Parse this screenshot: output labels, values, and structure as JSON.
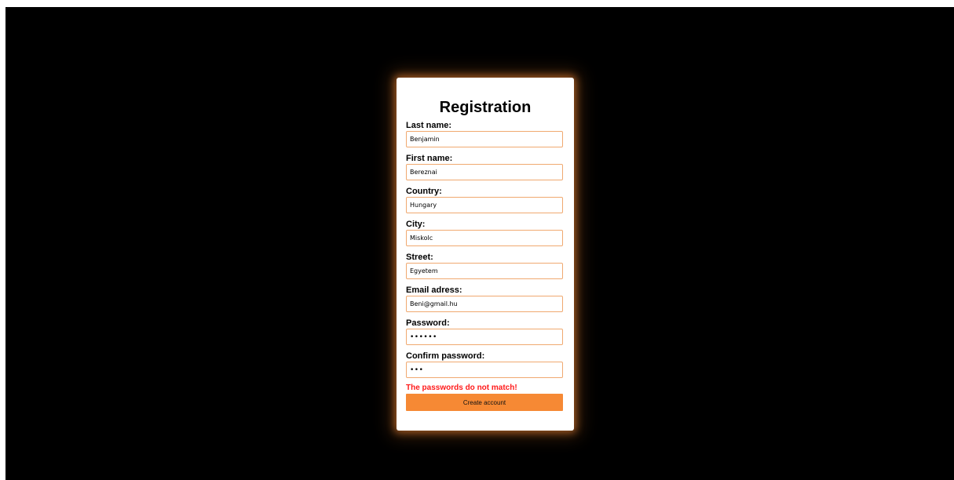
{
  "colors": {
    "background": "#000000",
    "card": "#ffffff",
    "accent": "#f68934",
    "input_border": "#f0a970",
    "error": "#ff1a1a"
  },
  "form": {
    "title": "Registration",
    "fields": [
      {
        "label": "Last name:",
        "value": "Benjamin",
        "type": "text"
      },
      {
        "label": "First name:",
        "value": "Bereznai",
        "type": "text"
      },
      {
        "label": "Country:",
        "value": "Hungary",
        "type": "text"
      },
      {
        "label": "City:",
        "value": "Miskolc",
        "type": "text"
      },
      {
        "label": "Street:",
        "value": "Egyetem",
        "type": "text"
      },
      {
        "label": "Email adress:",
        "value": "Beni@gmail.hu",
        "type": "email"
      },
      {
        "label": "Password:",
        "value": "••••••",
        "type": "password"
      },
      {
        "label": "Confirm password:",
        "value": "•••",
        "type": "password"
      }
    ],
    "error_message": "The passwords do not match!",
    "submit_label": "Create account"
  }
}
